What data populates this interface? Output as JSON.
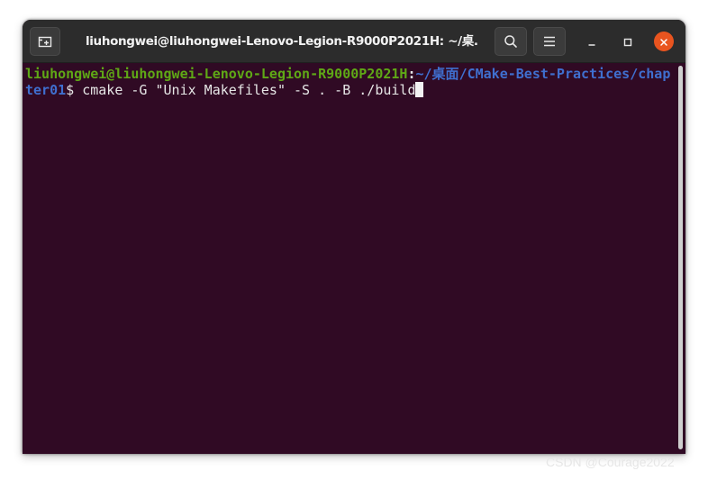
{
  "window": {
    "title": "liuhongwei@liuhongwei-Lenovo-Legion-R9000P2021H: ~/桌..."
  },
  "header_bar": {
    "new_tab_icon": "new-tab-icon",
    "search_icon": "search-icon",
    "menu_icon": "hamburger-menu-icon"
  },
  "window_controls": {
    "minimize_icon": "minimize-icon",
    "maximize_icon": "maximize-icon",
    "close_icon": "close-icon"
  },
  "terminal": {
    "prompt_user_host": "liuhongwei@liuhongwei-Lenovo-Legion-R9000P2021H",
    "prompt_colon": ":",
    "prompt_path_home": "~/",
    "prompt_path_cjk": "桌面",
    "prompt_path_rest": "/CMake-Best-Practices/chapter01",
    "prompt_dollar": "$",
    "command": " cmake -G \"Unix Makefiles\" -S . -B ./build"
  },
  "watermark": {
    "text": "CSDN @Courage2022"
  },
  "colors": {
    "terminal_bg": "#300a24",
    "headerbar_bg": "#2c2c2c",
    "prompt_user": "#5fa816",
    "prompt_path": "#3f6fcf",
    "close_button": "#e9541f"
  }
}
